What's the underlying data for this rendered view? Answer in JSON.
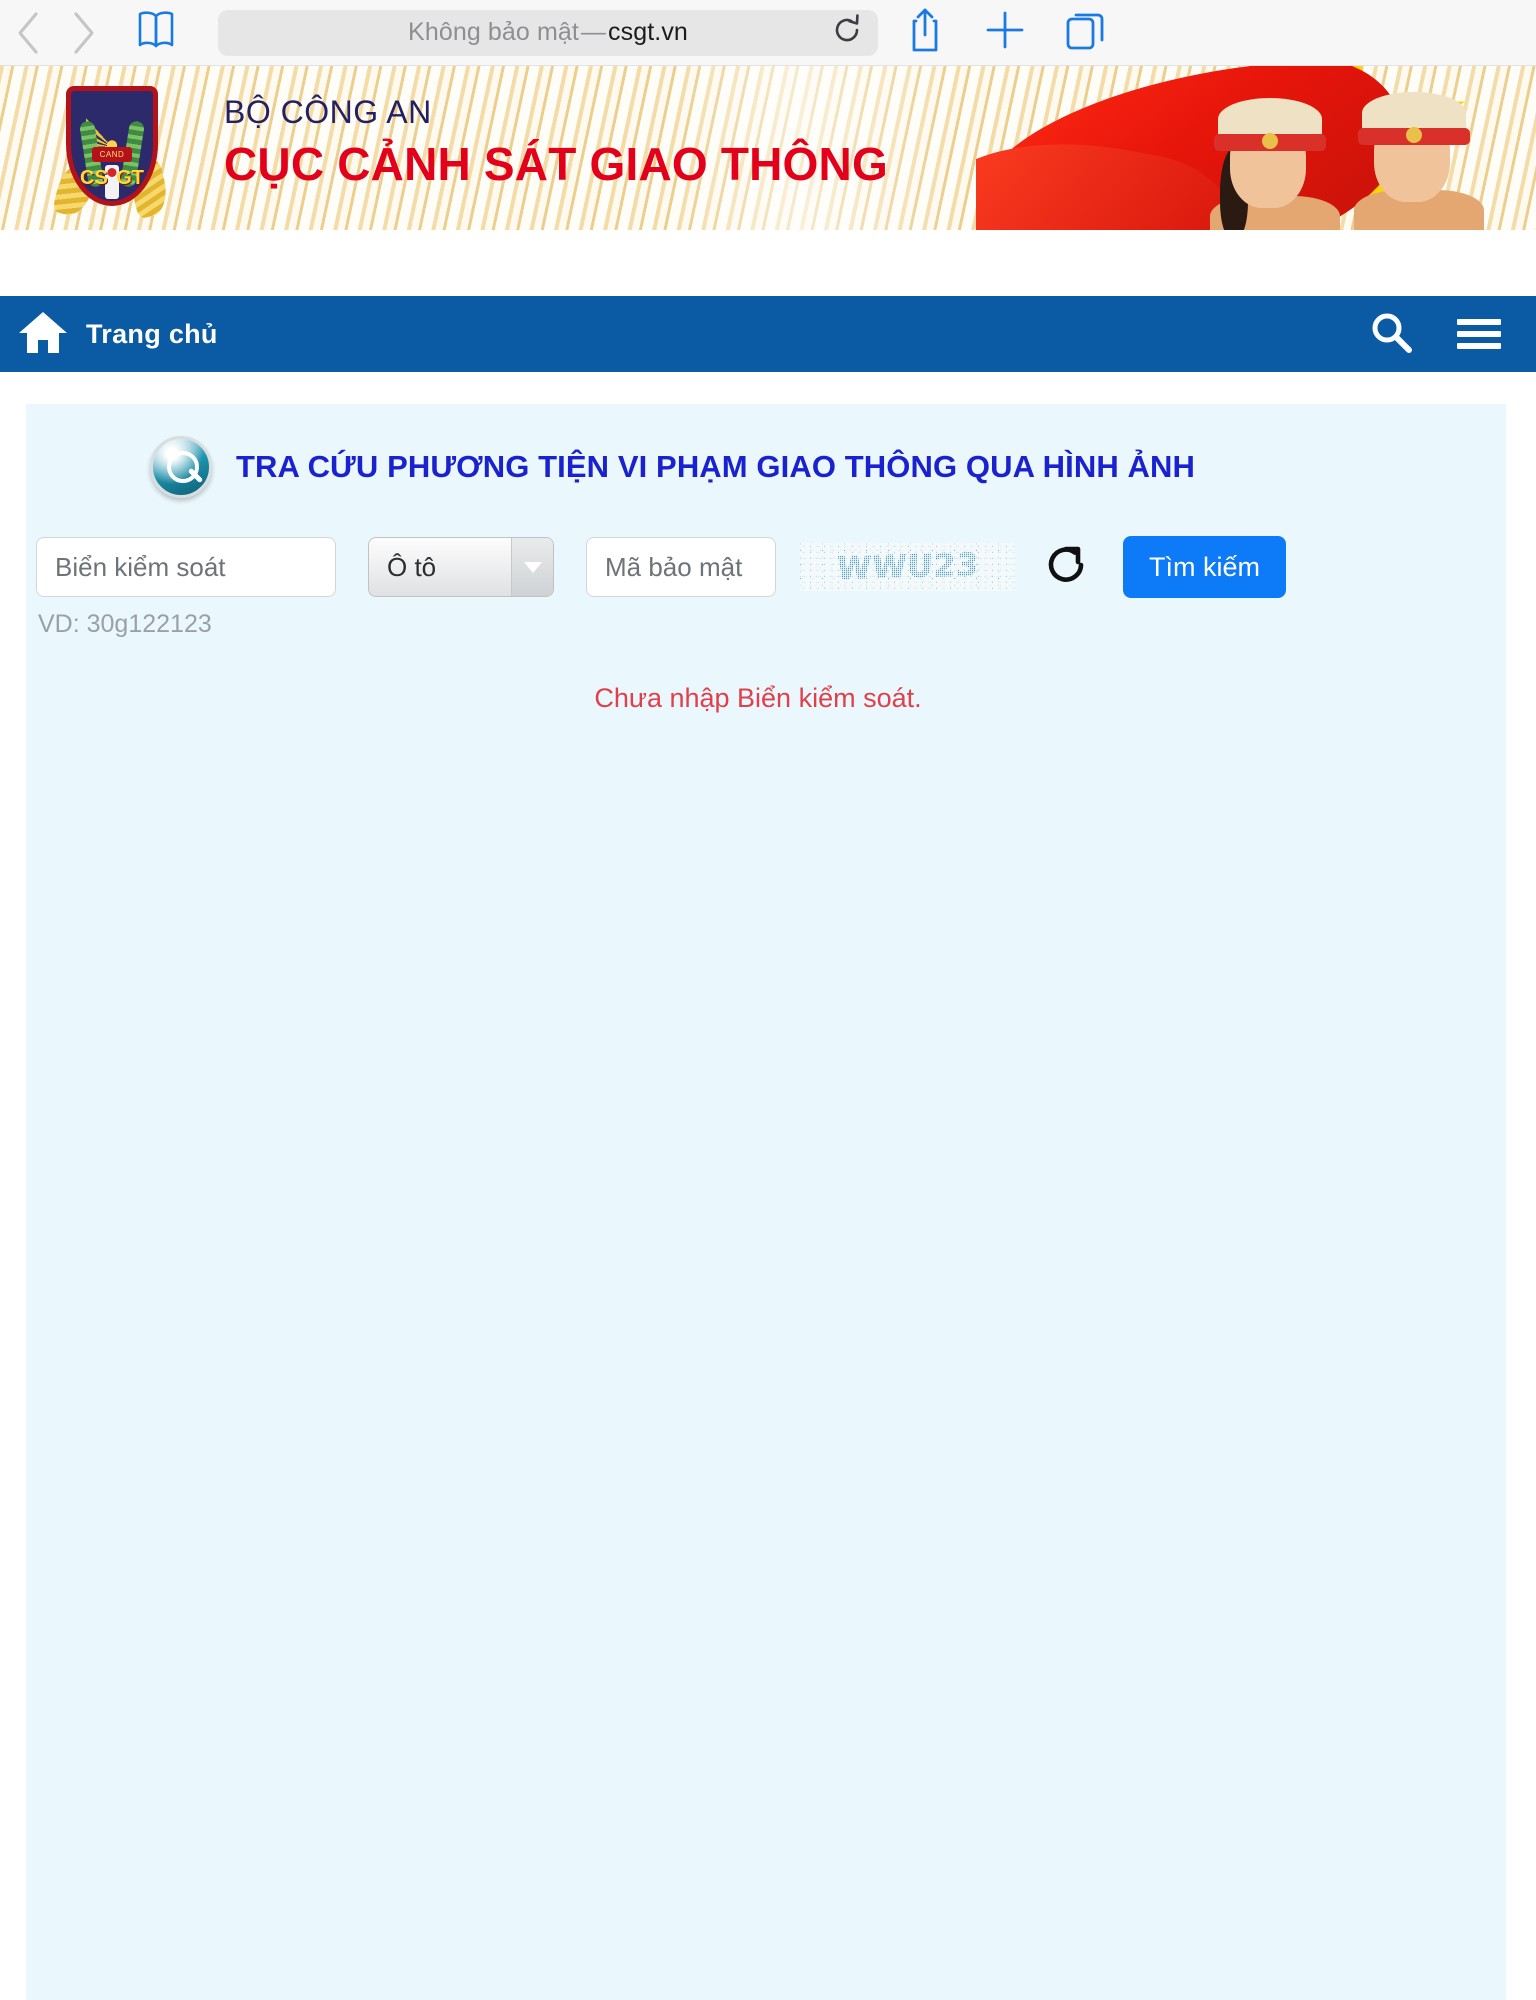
{
  "browser": {
    "back_icon": "chevron-left-icon",
    "forward_icon": "chevron-right-icon",
    "bookmarks_icon": "book-icon",
    "url_security_label": "Không bảo mật",
    "url_dash": "—",
    "url_host": "csgt.vn",
    "reload_icon": "reload-icon",
    "share_icon": "share-icon",
    "new_tab_icon": "plus-icon",
    "tabs_icon": "tabs-icon"
  },
  "banner": {
    "ministry": "BỘ CÔNG AN",
    "department": "CỤC CẢNH SÁT GIAO THÔNG",
    "emblem_cs": "CS",
    "emblem_gt": "GT",
    "emblem_band": "CAND"
  },
  "nav": {
    "home_icon": "home-icon",
    "home_label": "Trang chủ",
    "search_icon": "search-icon",
    "menu_icon": "hamburger-menu-icon",
    "background_color": "#0a5aa4"
  },
  "lookup": {
    "title_icon": "magnifier-icon",
    "title": "TRA CỨU PHƯƠNG TIỆN VI PHẠM GIAO THÔNG QUA HÌNH ẢNH",
    "title_color": "#1a22cf",
    "plate_input": {
      "value": "",
      "placeholder": "Biển kiểm soát"
    },
    "vehicle_select": {
      "selected": "Ô tô",
      "caret_icon": "chevron-down-icon"
    },
    "captcha_input": {
      "value": "",
      "placeholder": "Mã bảo mật"
    },
    "captcha_image_text": "WWU23",
    "refresh_icon": "refresh-captcha-icon",
    "search_button": "Tìm kiếm",
    "search_button_color": "#0d7bf7",
    "hint": "VD: 30g122123",
    "error_message": "Chưa nhập Biển kiểm soát.",
    "error_color": "#e0404b",
    "panel_background": "#eaf8fd"
  }
}
